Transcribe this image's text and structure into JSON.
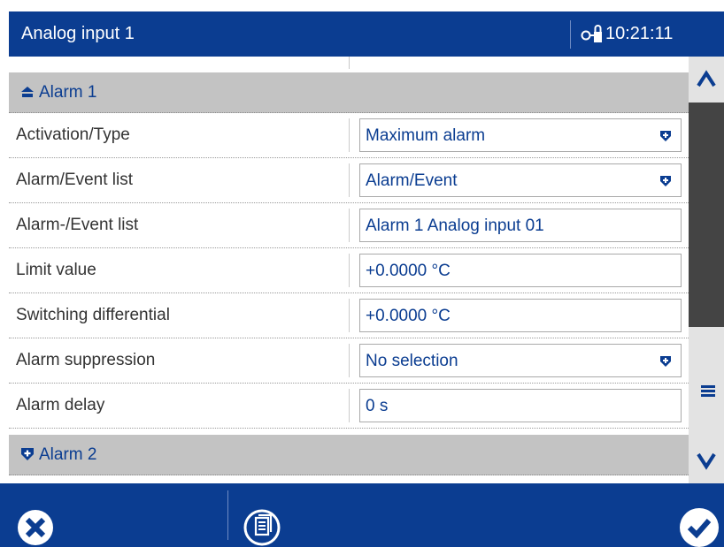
{
  "titlebar": {
    "title": "Analog input 1",
    "time": "10:21:11"
  },
  "sections": [
    {
      "label": "Alarm 1",
      "expanded": true,
      "rows": [
        {
          "label": "Activation/Type",
          "value": "Maximum alarm",
          "dropdown": true
        },
        {
          "label": "Alarm/Event list",
          "value": "Alarm/Event",
          "dropdown": true
        },
        {
          "label": "Alarm-/Event list",
          "value": "Alarm 1 Analog input 01",
          "dropdown": false
        },
        {
          "label": "Limit value",
          "value": "+0.0000 °C",
          "dropdown": false
        },
        {
          "label": "Switching differential",
          "value": "+0.0000 °C",
          "dropdown": false
        },
        {
          "label": "Alarm suppression",
          "value": "No selection",
          "dropdown": true
        },
        {
          "label": "Alarm delay",
          "value": "0 s",
          "dropdown": false
        }
      ]
    },
    {
      "label": "Alarm 2",
      "expanded": false
    }
  ],
  "footer": {
    "cancel_icon": "close-icon",
    "doc_icon": "document-icon",
    "ok_icon": "checkmark-icon"
  },
  "colors": {
    "brand": "#0b3d91",
    "section_bg": "#c3c3c3",
    "text": "#333333"
  }
}
